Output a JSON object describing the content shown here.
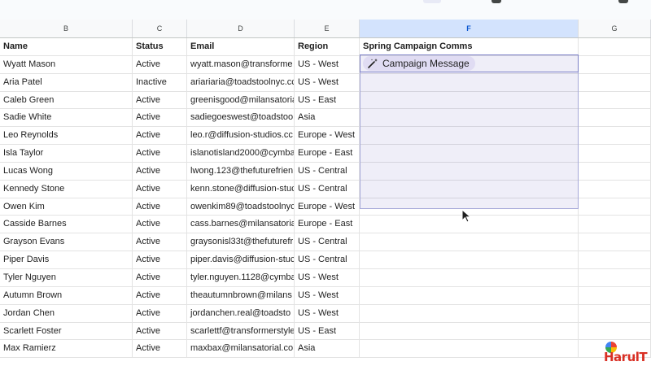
{
  "columns": [
    "B",
    "C",
    "D",
    "E",
    "F",
    "G"
  ],
  "selected_column": "F",
  "headers": {
    "name": "Name",
    "status": "Status",
    "email": "Email",
    "region": "Region",
    "campaign": "Spring Campaign Comms"
  },
  "rows": [
    {
      "name": "Wyatt Mason",
      "status": "Active",
      "email": "wyatt.mason@transforme",
      "region": "US - West"
    },
    {
      "name": "Aria Patel",
      "status": "Inactive",
      "email": "ariariaria@toadstoolnyc.cc",
      "region": "US - West"
    },
    {
      "name": "Caleb Green",
      "status": "Active",
      "email": "greenisgood@milansatoria",
      "region": "US - East"
    },
    {
      "name": "Sadie White",
      "status": "Active",
      "email": "sadiegoeswest@toadstoo",
      "region": "Asia"
    },
    {
      "name": "Leo Reynolds",
      "status": "Active",
      "email": "leo.r@diffusion-studios.cc",
      "region": "Europe - West"
    },
    {
      "name": "Isla Taylor",
      "status": "Active",
      "email": "islanotisland2000@cymba",
      "region": "Europe - East"
    },
    {
      "name": "Lucas Wong",
      "status": "Active",
      "email": "lwong.123@thefuturefrien",
      "region": "US - Central"
    },
    {
      "name": "Kennedy Stone",
      "status": "Active",
      "email": "kenn.stone@diffusion-stuc",
      "region": "US - Central"
    },
    {
      "name": "Owen Kim",
      "status": "Active",
      "email": "owenkim89@toadstoolnyc",
      "region": "Europe - West"
    },
    {
      "name": "Casside Barnes",
      "status": "Active",
      "email": "cass.barnes@milansatoria",
      "region": "Europe - East"
    },
    {
      "name": "Grayson Evans",
      "status": "Active",
      "email": "graysonisl33t@thefuturefr",
      "region": "US - Central"
    },
    {
      "name": "Piper Davis",
      "status": "Active",
      "email": "piper.davis@diffusion-stuc",
      "region": "US - Central"
    },
    {
      "name": "Tyler Nguyen",
      "status": "Active",
      "email": "tyler.nguyen.1128@cymba",
      "region": "US - West"
    },
    {
      "name": "Autumn Brown",
      "status": "Active",
      "email": "theautumnbrown@milans",
      "region": "US - West"
    },
    {
      "name": "Jordan Chen",
      "status": "Active",
      "email": "jordanchen.real@toadsto",
      "region": "US - West"
    },
    {
      "name": "Scarlett Foster",
      "status": "Active",
      "email": "scarlettf@transformerstyle",
      "region": "US - East"
    },
    {
      "name": "Max Ramierz",
      "status": "Active",
      "email": "maxbax@milansatorial.co",
      "region": "Asia"
    }
  ],
  "campaign_chip": {
    "label": "Campaign Message",
    "icon": "magic-wand-icon"
  },
  "watermark": {
    "text": "HarulT",
    "icon": "google-g-icon"
  },
  "colors": {
    "selection": "#605abe",
    "chip_bg": "#e0dcf3",
    "column_selected": "#d3e3fd"
  }
}
